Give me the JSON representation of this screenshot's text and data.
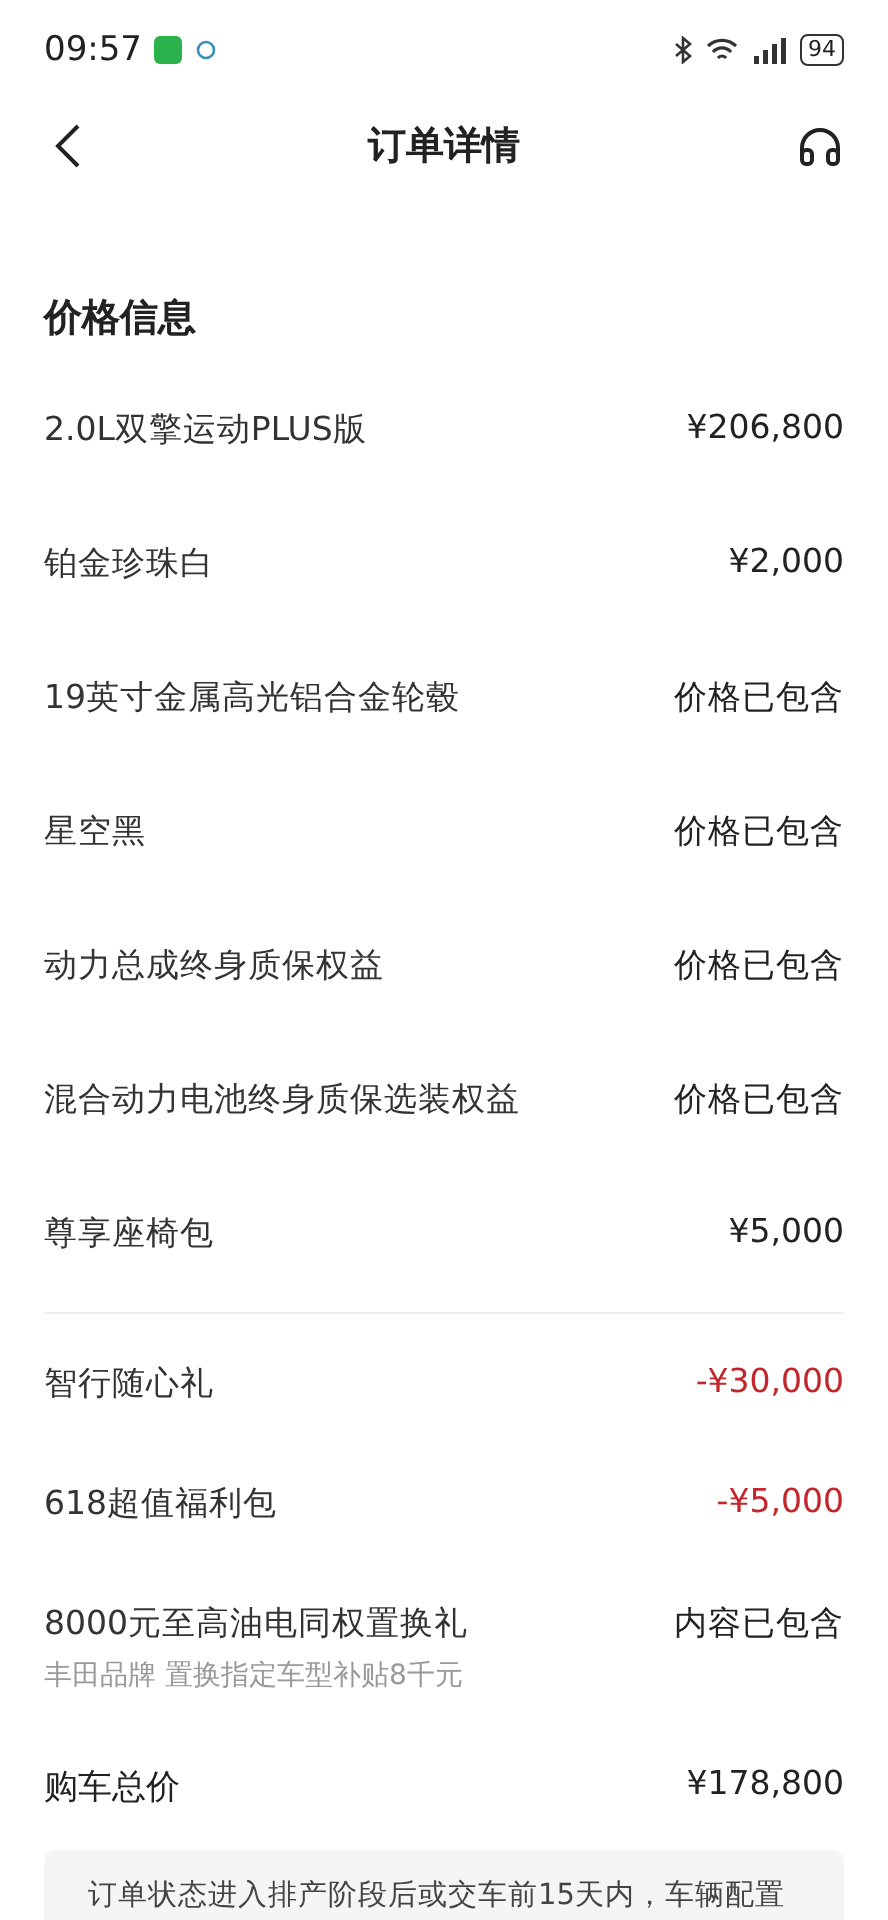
{
  "status_bar": {
    "time": "09:57",
    "battery": "94"
  },
  "header": {
    "title": "订单详情"
  },
  "price_info": {
    "title": "价格信息",
    "items": [
      {
        "name": "2.0L双擎运动PLUS版",
        "value": "¥206,800",
        "kind": "price"
      },
      {
        "name": "铂金珍珠白",
        "value": "¥2,000",
        "kind": "price"
      },
      {
        "name": "19英寸金属高光铝合金轮毂",
        "value": "价格已包含",
        "kind": "price"
      },
      {
        "name": "星空黑",
        "value": "价格已包含",
        "kind": "price"
      },
      {
        "name": "动力总成终身质保权益",
        "value": "价格已包含",
        "kind": "price"
      },
      {
        "name": "混合动力电池终身质保选装权益",
        "value": "价格已包含",
        "kind": "price"
      },
      {
        "name": "尊享座椅包",
        "value": "¥5,000",
        "kind": "price"
      }
    ],
    "offers": [
      {
        "name": "智行随心礼",
        "value": "-¥30,000",
        "kind": "discount"
      },
      {
        "name": "618超值福利包",
        "value": "-¥5,000",
        "kind": "discount"
      },
      {
        "name": "8000元至高油电同权置换礼",
        "value": "内容已包含",
        "kind": "price",
        "note": "丰田品牌 置换指定车型补贴8千元"
      }
    ],
    "total": {
      "label": "购车总价",
      "value": "¥178,800"
    }
  },
  "notice": {
    "text": "订单状态进入排产阶段后或交车前15天内，车辆配置"
  }
}
